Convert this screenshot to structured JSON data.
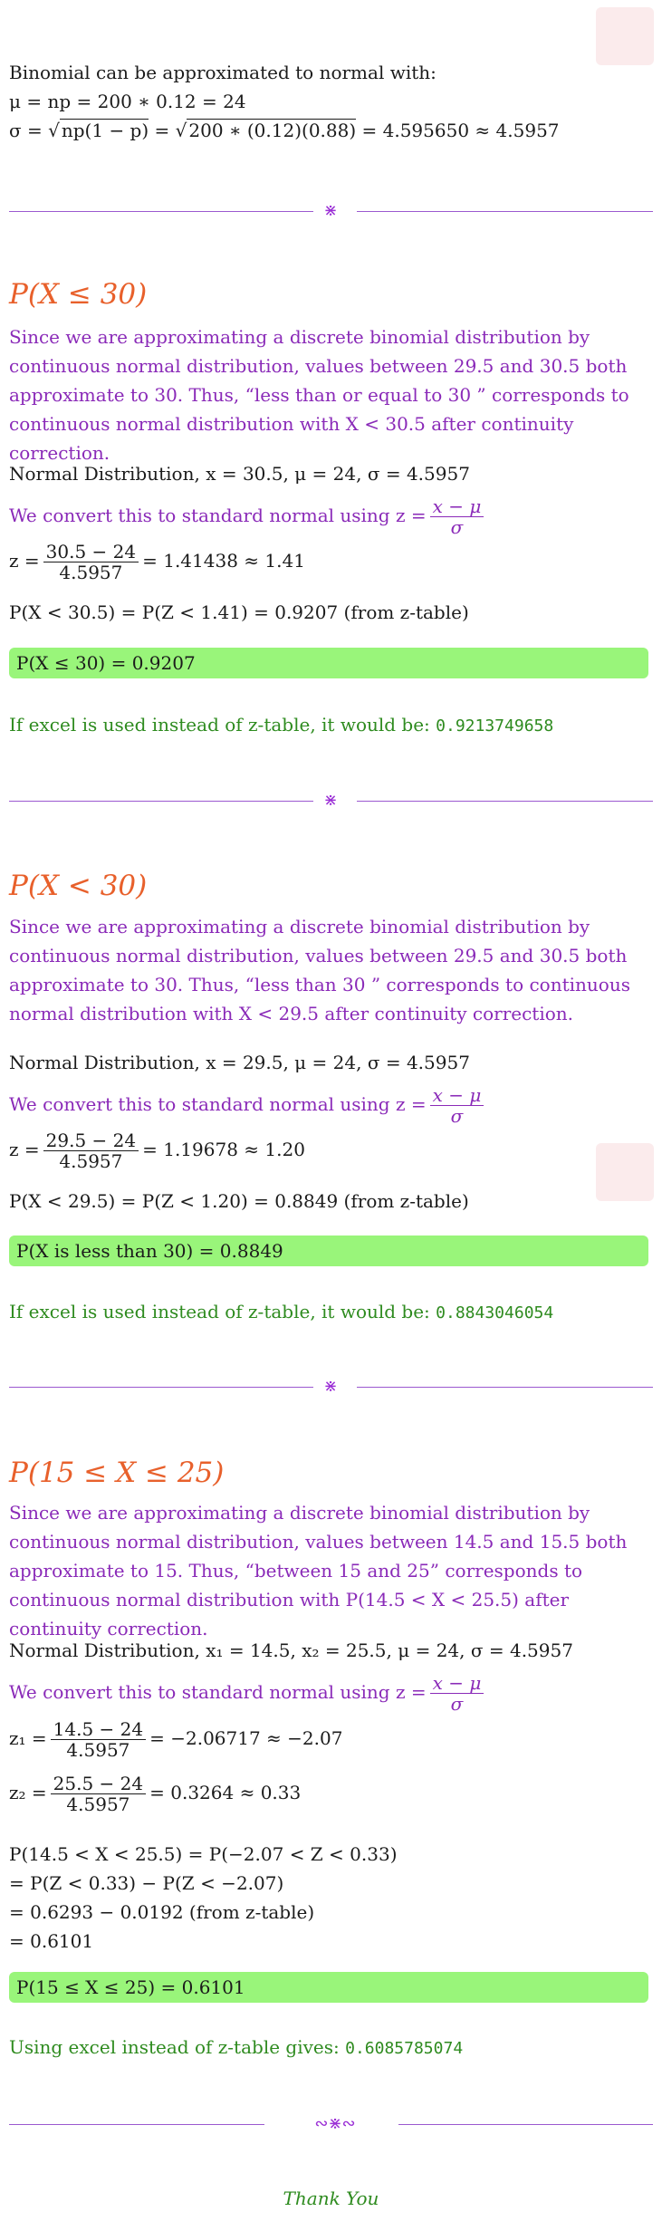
{
  "intro": {
    "line1": "Binomial can be approximated to normal with:",
    "mu": "μ = np = 200 ∗ 0.12 = 24",
    "sigma_lhs": "σ = √",
    "sigma_rad1": "np(1 − p)",
    "sigma_mid": " = √",
    "sigma_rad2": "200 ∗ (0.12)(0.88)",
    "sigma_rhs": " = 4.595650 ≈ 4.5957"
  },
  "sections": [
    {
      "heading": "P(X ≤ 30)",
      "explain": "Since we are approximating a discrete binomial distribution by continuous normal distribution, values between 29.5 and 30.5 both approximate to 30.  Thus, “less than or equal to 30 ” corresponds to continuous normal distribution with X < 30.5 after continuity correction.",
      "normal": "Normal Distribution, x = 30.5,  μ = 24,  σ = 4.5957",
      "convert": "We convert this to standard normal using z =",
      "frac_num": "x − μ",
      "frac_den": "σ",
      "z_lhs": "z =",
      "z_num": "30.5 − 24",
      "z_den": "4.5957",
      "z_rhs": "= 1.41438 ≈ 1.41",
      "prob": "P(X < 30.5) = P(Z < 1.41) = 0.9207 (from z-table)",
      "answer": "P(X ≤ 30) = 0.9207",
      "excel_text": "If excel is used instead of z-table, it would be: ",
      "excel_value": "0.9213749658"
    },
    {
      "heading": "P(X < 30)",
      "explain": "Since we are approximating a discrete binomial distribution by continuous normal distribution, values between 29.5 and 30.5 both approximate to 30.  Thus, “less than 30 ” corresponds to continuous normal distribution with X < 29.5 after continuity correction.",
      "normal": "Normal Distribution, x = 29.5,  μ = 24,  σ = 4.5957",
      "convert": "We convert this to standard normal using z =",
      "frac_num": "x − μ",
      "frac_den": "σ",
      "z_lhs": "z =",
      "z_num": "29.5 − 24",
      "z_den": "4.5957",
      "z_rhs": "= 1.19678 ≈ 1.20",
      "prob": "P(X < 29.5) = P(Z < 1.20) = 0.8849 (from z-table)",
      "answer": "P(X is less than 30) = 0.8849",
      "excel_text": "If excel is used instead of z-table, it would be: ",
      "excel_value": "0.8843046054"
    }
  ],
  "section3": {
    "heading": "P(15 ≤ X ≤ 25)",
    "explain": "Since we are approximating a discrete binomial distribution by continuous normal distribution, values between 14.5 and 15.5 both approximate to 15. Thus, “between 15 and 25” corresponds to continuous normal distribution with P(14.5 < X < 25.5) after continuity correction.",
    "normal": "Normal Distribution, x₁ = 14.5, x₂ = 25.5,  μ = 24,  σ = 4.5957",
    "convert": "We convert this to standard normal using z =",
    "frac_num": "x − μ",
    "frac_den": "σ",
    "z1_lhs": "z₁ =",
    "z1_num": "14.5 − 24",
    "z1_den": "4.5957",
    "z1_rhs": "= −2.06717 ≈ −2.07",
    "z2_lhs": "z₂ =",
    "z2_num": "25.5 − 24",
    "z2_den": "4.5957",
    "z2_rhs": "= 0.3264 ≈ 0.33",
    "calc1": "P(14.5 < X < 25.5) = P(−2.07 < Z < 0.33)",
    "calc2": "= P(Z < 0.33) − P(Z < −2.07)",
    "calc3": "= 0.6293 − 0.0192 (from z-table)",
    "calc4": "= 0.6101",
    "answer": "P(15 ≤ X ≤ 25) = 0.6101",
    "excel_text": "Using excel instead of z-table gives: ",
    "excel_value": "0.6085785074"
  },
  "ornament": "⋇",
  "final_ornament": "∾⋇∾",
  "thanks": "Thank You"
}
